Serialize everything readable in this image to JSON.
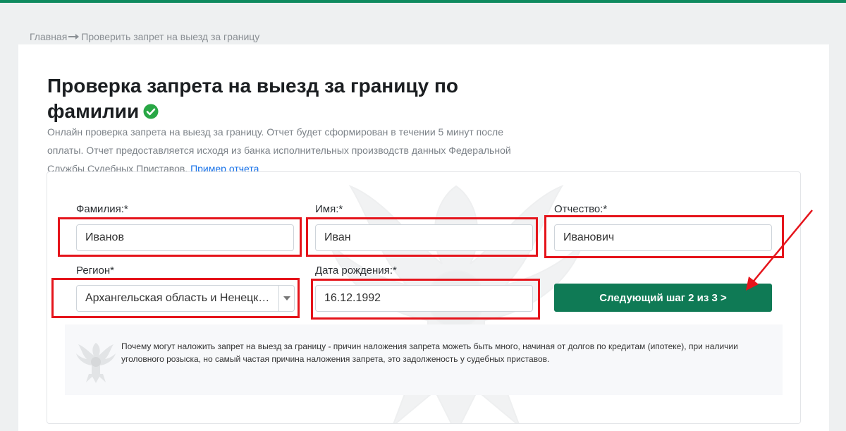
{
  "breadcrumb": {
    "home": "Главная",
    "current": "Проверить запрет на выезд за границу"
  },
  "page": {
    "title": "Проверка запрета на выезд за границу по фамилии",
    "description": "Онлайн проверка запрета на выезд за границу. Отчет будет сформирован в течении 5 минут после оплаты. Отчет предоставляется исходя из банка исполнительных производств данных Федеральной Службы Судебных Приставов.",
    "sample_link": "Пример отчета"
  },
  "form": {
    "surname_label": "Фамилия:*",
    "surname_value": "Иванов",
    "name_label": "Имя:*",
    "name_value": "Иван",
    "patronymic_label": "Отчество:*",
    "patronymic_value": "Иванович",
    "region_label": "Регион*",
    "region_value": "Архангельская область и Ненецкий автономный округ",
    "birthdate_label": "Дата рождения:*",
    "birthdate_value": "16.12.1992",
    "next_button": "Следующий шаг 2 из 3 >"
  },
  "info": {
    "text": "Почему могут наложить запрет на выезд за границу - причин наложения запрета можеть быть много, начиная от долгов по кредитам (ипотеке), при наличии уголовного розыска, но самый частая причина наложения запрета, это задолженость у судебных приставов."
  },
  "colors": {
    "brand_green": "#0f7a55",
    "annotation_red": "#e5141b",
    "link_blue": "#1a73e8"
  },
  "icons": {
    "breadcrumb_separator": "arrow-right-icon",
    "title_badge": "check-circle-icon",
    "select_toggle": "caret-down-icon",
    "watermark": "eagle-emblem-icon"
  }
}
